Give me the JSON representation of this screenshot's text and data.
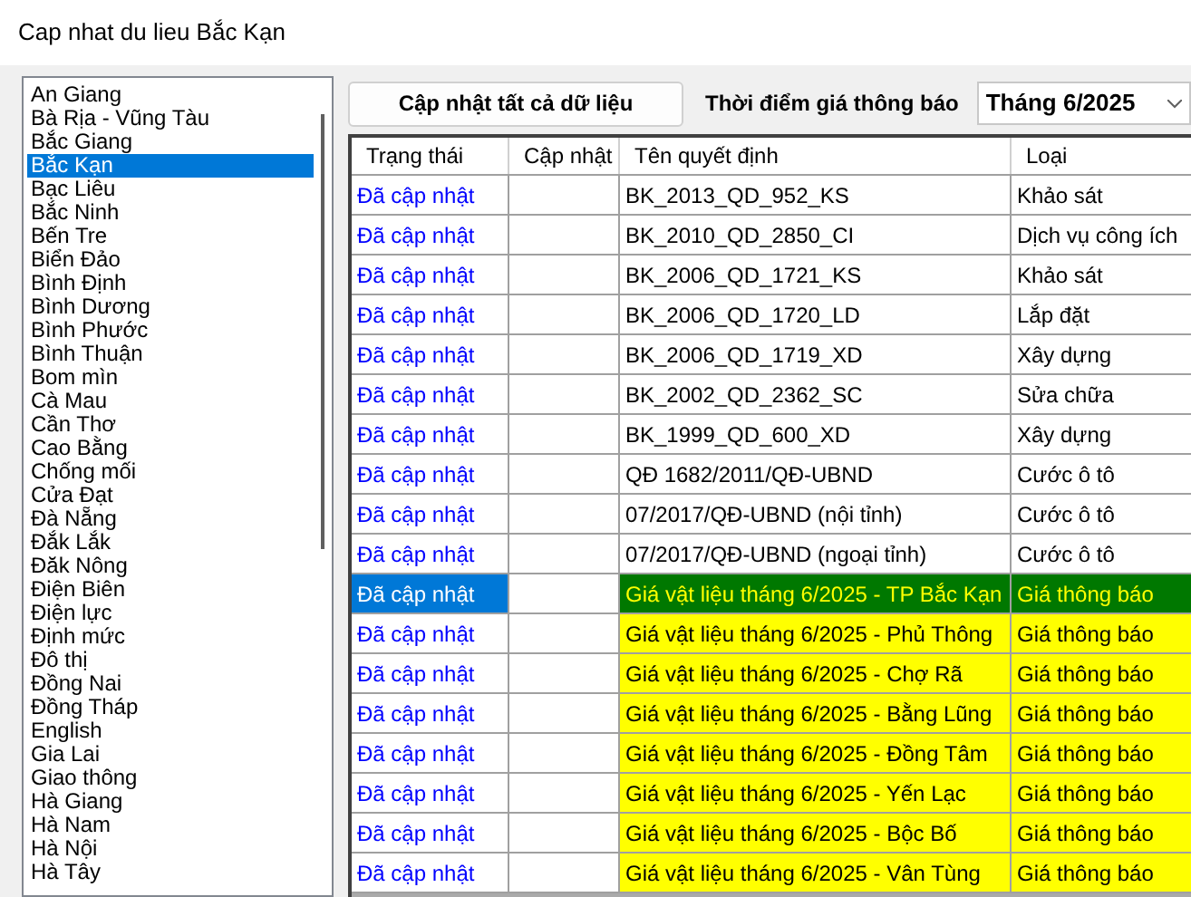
{
  "window": {
    "title": "Cap nhat du lieu Bắc Kạn"
  },
  "provinces": [
    {
      "label": "An Giang",
      "selected": false
    },
    {
      "label": "Bà Rịa - Vũng Tàu",
      "selected": false
    },
    {
      "label": "Bắc Giang",
      "selected": false
    },
    {
      "label": "Bắc Kạn",
      "selected": true
    },
    {
      "label": "Bạc Liêu",
      "selected": false
    },
    {
      "label": "Bắc Ninh",
      "selected": false
    },
    {
      "label": "Bến Tre",
      "selected": false
    },
    {
      "label": "Biển Đảo",
      "selected": false
    },
    {
      "label": "Bình Định",
      "selected": false
    },
    {
      "label": "Bình Dương",
      "selected": false
    },
    {
      "label": "Bình Phước",
      "selected": false
    },
    {
      "label": "Bình Thuận",
      "selected": false
    },
    {
      "label": "Bom mìn",
      "selected": false
    },
    {
      "label": "Cà Mau",
      "selected": false
    },
    {
      "label": "Cần Thơ",
      "selected": false
    },
    {
      "label": "Cao Bằng",
      "selected": false
    },
    {
      "label": "Chống mối",
      "selected": false
    },
    {
      "label": "Cửa Đạt",
      "selected": false
    },
    {
      "label": "Đà Nẵng",
      "selected": false
    },
    {
      "label": "Đắk Lắk",
      "selected": false
    },
    {
      "label": "Đăk Nông",
      "selected": false
    },
    {
      "label": "Điện Biên",
      "selected": false
    },
    {
      "label": "Điện lực",
      "selected": false
    },
    {
      "label": "Định mức",
      "selected": false
    },
    {
      "label": "Đô thị",
      "selected": false
    },
    {
      "label": "Đồng Nai",
      "selected": false
    },
    {
      "label": "Đồng Tháp",
      "selected": false
    },
    {
      "label": "English",
      "selected": false
    },
    {
      "label": "Gia Lai",
      "selected": false
    },
    {
      "label": "Giao thông",
      "selected": false
    },
    {
      "label": "Hà Giang",
      "selected": false
    },
    {
      "label": "Hà Nam",
      "selected": false
    },
    {
      "label": "Hà Nội",
      "selected": false
    },
    {
      "label": "Hà Tây",
      "selected": false
    }
  ],
  "update_all_button": "Cập nhật tất cả dữ liệu",
  "price_time": {
    "label": "Thời điểm giá thông báo",
    "value": "Tháng 6/2025"
  },
  "table": {
    "columns": [
      "Trạng thái",
      "Cập nhật",
      "Tên quyết định",
      "Loại"
    ],
    "rows": [
      {
        "status": "Đã cập nhật",
        "name": "BK_2013_QD_952_KS",
        "type": "Khảo sát",
        "kind": "decision",
        "selected": false
      },
      {
        "status": "Đã cập nhật",
        "name": "BK_2010_QD_2850_CI",
        "type": "Dịch vụ công ích",
        "kind": "decision",
        "selected": false
      },
      {
        "status": "Đã cập nhật",
        "name": "BK_2006_QD_1721_KS",
        "type": "Khảo sát",
        "kind": "decision",
        "selected": false
      },
      {
        "status": "Đã cập nhật",
        "name": "BK_2006_QD_1720_LD",
        "type": "Lắp đặt",
        "kind": "decision",
        "selected": false
      },
      {
        "status": "Đã cập nhật",
        "name": "BK_2006_QD_1719_XD",
        "type": "Xây dựng",
        "kind": "decision",
        "selected": false
      },
      {
        "status": "Đã cập nhật",
        "name": "BK_2002_QD_2362_SC",
        "type": "Sửa chữa",
        "kind": "decision",
        "selected": false
      },
      {
        "status": "Đã cập nhật",
        "name": "BK_1999_QD_600_XD",
        "type": "Xây dựng",
        "kind": "decision",
        "selected": false
      },
      {
        "status": "Đã cập nhật",
        "name": "QĐ 1682/2011/QĐ-UBND",
        "type": "Cước ô tô",
        "kind": "decision",
        "selected": false
      },
      {
        "status": "Đã cập nhật",
        "name": "07/2017/QĐ-UBND (nội tỉnh)",
        "type": "Cước ô tô",
        "kind": "decision",
        "selected": false
      },
      {
        "status": "Đã cập nhật",
        "name": "07/2017/QĐ-UBND (ngoại tỉnh)",
        "type": "Cước ô tô",
        "kind": "decision",
        "selected": false
      },
      {
        "status": "Đã cập nhật",
        "name": "Giá vật liệu tháng 6/2025 - TP Bắc Kạn",
        "type": "Giá thông báo",
        "kind": "price",
        "selected": true
      },
      {
        "status": "Đã cập nhật",
        "name": "Giá vật liệu tháng 6/2025 - Phủ Thông",
        "type": "Giá thông báo",
        "kind": "price",
        "selected": false
      },
      {
        "status": "Đã cập nhật",
        "name": "Giá vật liệu tháng 6/2025 - Chợ Rã",
        "type": "Giá thông báo",
        "kind": "price",
        "selected": false
      },
      {
        "status": "Đã cập nhật",
        "name": "Giá vật liệu tháng 6/2025 - Bằng Lũng",
        "type": "Giá thông báo",
        "kind": "price",
        "selected": false
      },
      {
        "status": "Đã cập nhật",
        "name": "Giá vật liệu tháng 6/2025 - Đồng Tâm",
        "type": "Giá thông báo",
        "kind": "price",
        "selected": false
      },
      {
        "status": "Đã cập nhật",
        "name": "Giá vật liệu tháng 6/2025 - Yến Lạc",
        "type": "Giá thông báo",
        "kind": "price",
        "selected": false
      },
      {
        "status": "Đã cập nhật",
        "name": "Giá vật liệu tháng 6/2025 - Bộc Bố",
        "type": "Giá thông báo",
        "kind": "price",
        "selected": false
      },
      {
        "status": "Đã cập nhật",
        "name": "Giá vật liệu tháng 6/2025 - Vân Tùng",
        "type": "Giá thông báo",
        "kind": "price",
        "selected": false
      }
    ]
  }
}
